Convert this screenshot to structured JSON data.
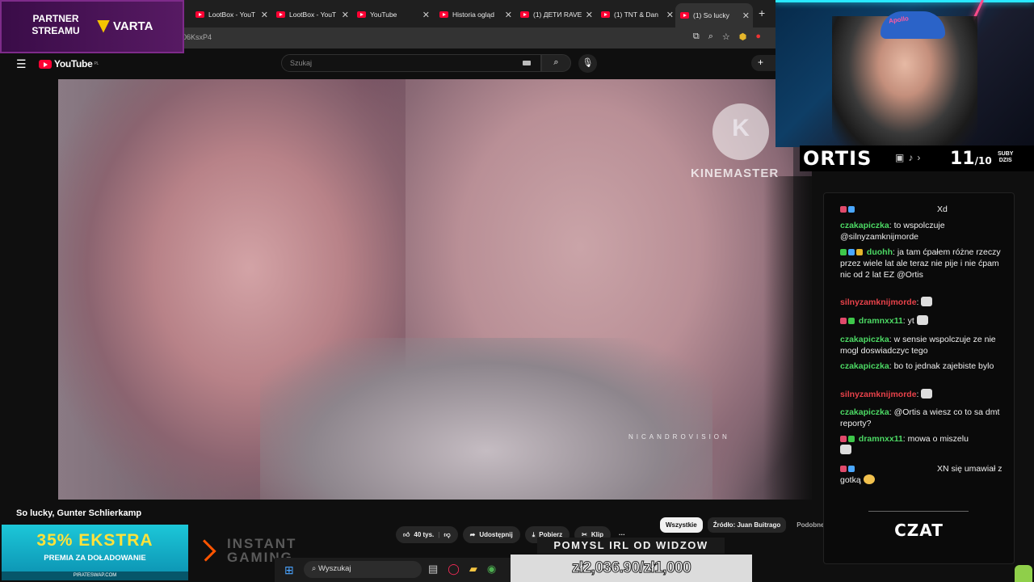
{
  "browser": {
    "tabs": [
      {
        "label": "LootBox - YouT"
      },
      {
        "label": "LootBox - YouT"
      },
      {
        "label": "YouTube"
      },
      {
        "label": "Historia ogląd"
      },
      {
        "label": "(1) ДЕТИ RAVE"
      },
      {
        "label": "(1) TNT & Dan"
      },
      {
        "label": "(1) So lucky"
      }
    ],
    "url_fragment": "06KsxP4",
    "new_tab": "+"
  },
  "youtube": {
    "logo": "YouTube",
    "region": "PL",
    "search_placeholder": "Szukaj",
    "create_label": "+"
  },
  "video": {
    "watermark": "KINEMASTER",
    "credit": "NICANDROVISION",
    "title": "So lucky, Gunter Schlierkamp",
    "likes": "40 tys.",
    "share": "Udostępnij",
    "download": "Pobierz",
    "clip": "Klip",
    "more": "···"
  },
  "chips": [
    "Wszystkie",
    "Źródło: Juan Buitrago",
    "Podobne"
  ],
  "partner": {
    "label_line1": "PARTNER",
    "label_line2": "STREAMU",
    "brand": "VARTA"
  },
  "streamer": {
    "name": "ORTIS",
    "subs_count": "11",
    "subs_goal": "/10",
    "subs_label_1": "SUBY",
    "subs_label_2": "DZIS",
    "cap_text": "Apollo"
  },
  "chat": {
    "title": "CZAT",
    "messages": [
      {
        "user": "",
        "text": "Xd"
      },
      {
        "user": "czakapiczka",
        "text": "to wspolczuje @silnyzamknijmorde"
      },
      {
        "user": "duohh",
        "text": "ja tam ćpałem różne rzeczy przez wiele lat ale teraz nie pije i nie ćpam nic od 2 lat EZ @Ortis"
      },
      {
        "user": "silnyzamknijmorde",
        "text": ""
      },
      {
        "user": "dramnxx11",
        "text": "yt"
      },
      {
        "user": "czakapiczka",
        "text": "w sensie wspolczuje ze nie mogl doswiadczyc tego"
      },
      {
        "user": "czakapiczka",
        "text": "bo to jednak zajebiste bylo"
      },
      {
        "user": "silnyzamknijmorde",
        "text": ""
      },
      {
        "user": "czakapiczka",
        "text": "@Ortis a wiesz co to sa dmt reporty?"
      },
      {
        "user": "dramnxx11",
        "text": "mowa o miszelu"
      },
      {
        "user": "",
        "text": "XN się umawiał z gotką"
      }
    ]
  },
  "promo": {
    "big": "35% EKSTRA",
    "mid": "PREMIA ZA DOŁADOWANIE",
    "small": "PIRATESWAP.COM"
  },
  "instant": {
    "line1": "INSTANT",
    "line2": "GAMING"
  },
  "taskbar": {
    "search": "Wyszukaj"
  },
  "overlay": {
    "idea": "POMYSL IRL OD WIDZOW",
    "donation": "zł2,036.90/zł1,000"
  },
  "colors": {
    "chat_user_green": "#4cd964",
    "chat_user_red": "#e8424a",
    "partner_bg": "#571a63",
    "promo_yellow": "#ffe23a"
  }
}
